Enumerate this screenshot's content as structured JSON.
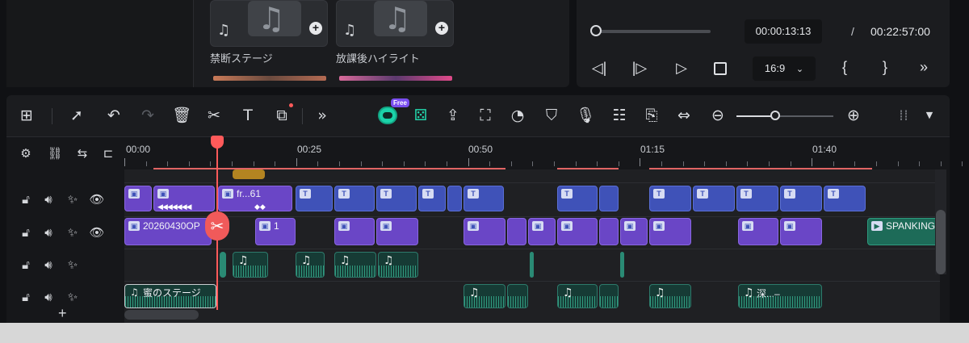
{
  "media": {
    "cards": [
      {
        "label": "禁断ステージ"
      },
      {
        "label": "放課後ハイライト"
      }
    ],
    "card_plus": "+"
  },
  "player": {
    "current_time": "00:00:13:13",
    "separator": "/",
    "total_time": "00:22:57:00",
    "aspect_ratio": "16:9",
    "progress": 0.02
  },
  "toolbar": {
    "ai_badge": "Free"
  },
  "timeline": {
    "ruler_ticks": [
      "00:00",
      "00:25",
      "00:50",
      "01:15",
      "01:40"
    ],
    "add_track": "+",
    "tracks": {
      "title_clip_label": "fr...61",
      "video_clip_label": "20260430OP",
      "video_clip_label_2": "1",
      "green_clip_label": "SPANKING",
      "audio_clip_label": "蜜のステージ",
      "audio_clip_label_2": "深...–"
    }
  }
}
